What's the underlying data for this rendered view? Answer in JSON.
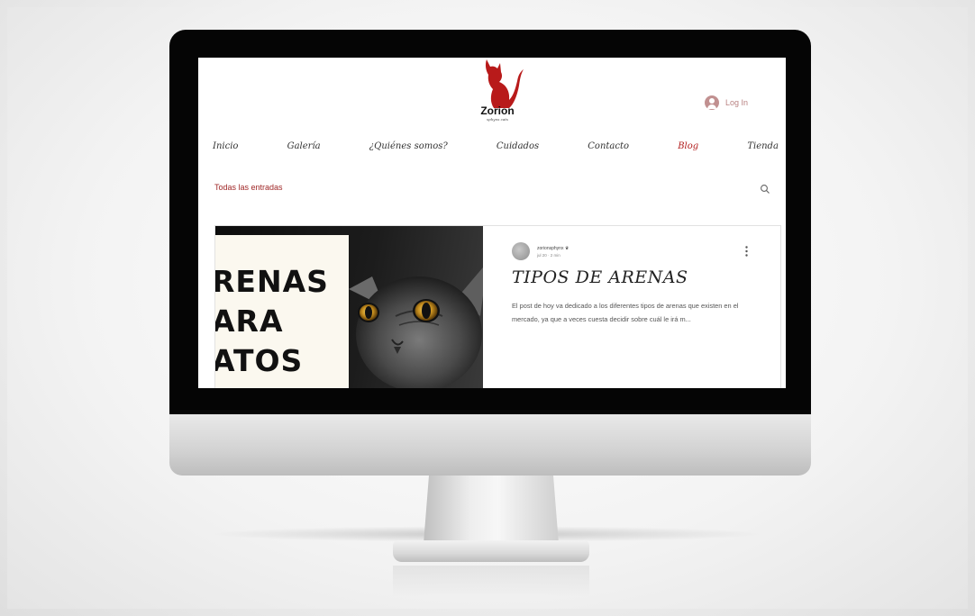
{
  "site": {
    "logo_name": "Zorion",
    "logo_tagline": "sphynx cats",
    "login_label": "Log In"
  },
  "nav": {
    "items": [
      {
        "label": "Inicio",
        "active": false
      },
      {
        "label": "Galería",
        "active": false
      },
      {
        "label": "¿Quiénes somos?",
        "active": false
      },
      {
        "label": "Cuidados",
        "active": false
      },
      {
        "label": "Contacto",
        "active": false
      },
      {
        "label": "Blog",
        "active": true
      },
      {
        "label": "Tienda",
        "active": false
      }
    ]
  },
  "blog": {
    "filter_label": "Todas las entradas",
    "search_icon": "search-icon"
  },
  "post": {
    "image_text": [
      "RENAS",
      "ARA",
      "ATOS"
    ],
    "author": "zorionsphynx",
    "author_badge": "crown-icon",
    "meta": "jul 20 · 2 min",
    "title": "TIPOS DE ARENAS",
    "excerpt": "El post de hoy va dedicado a los diferentes tipos de arenas que existen en el mercado, ya que a veces cuesta decidir sobre cuál le irá m..."
  },
  "colors": {
    "accent": "#b21e1e",
    "login": "#b98282",
    "bezel": "#050505"
  }
}
